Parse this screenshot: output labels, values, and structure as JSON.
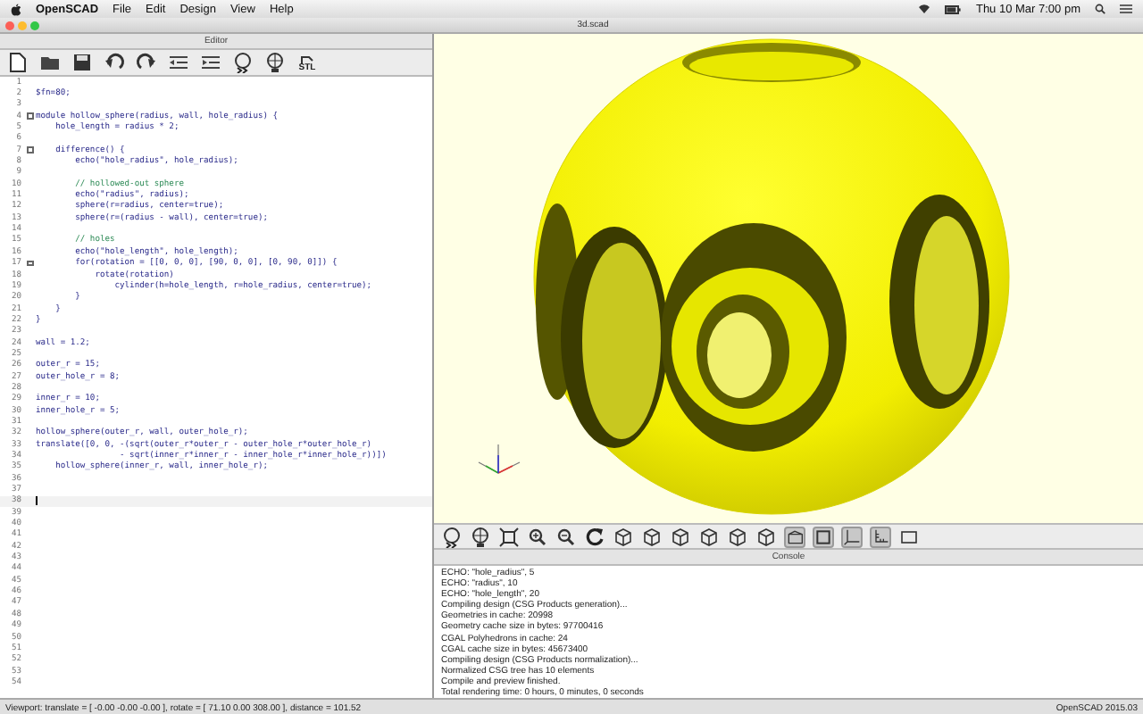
{
  "menubar": {
    "app": "OpenSCAD",
    "menus": [
      "File",
      "Edit",
      "Design",
      "View",
      "Help"
    ],
    "clock": "Thu 10 Mar  7:00 pm"
  },
  "window": {
    "title": "3d.scad"
  },
  "editor": {
    "title": "Editor",
    "toolbar": [
      {
        "kind": "new"
      },
      {
        "kind": "open"
      },
      {
        "kind": "save"
      },
      {
        "kind": "undo"
      },
      {
        "kind": "redo"
      },
      {
        "kind": "unindent"
      },
      {
        "kind": "indent"
      },
      {
        "kind": "preview"
      },
      {
        "kind": "render"
      },
      {
        "kind": "stl",
        "label": "STL"
      }
    ],
    "lines": [
      {
        "number": "1",
        "fold": false,
        "current": false
      },
      {
        "number": "2",
        "text": "$fn=80;",
        "kind": "code",
        "fold": false,
        "current": false
      },
      {
        "number": "3",
        "fold": false,
        "current": false
      },
      {
        "number": "4",
        "text": "module hollow_sphere(radius, wall, hole_radius) {",
        "kind": "code",
        "fold": true,
        "current": false
      },
      {
        "number": "5",
        "text": "    hole_length = radius * 2;",
        "kind": "code",
        "fold": false,
        "current": false
      },
      {
        "number": "6",
        "fold": false,
        "current": false
      },
      {
        "number": "7",
        "text": "    difference() {",
        "kind": "code",
        "fold": true,
        "current": false
      },
      {
        "number": "8",
        "text": "        echo(\"hole_radius\", hole_radius);",
        "kind": "code",
        "fold": false,
        "current": false
      },
      {
        "number": "9",
        "fold": false,
        "current": false
      },
      {
        "number": "10",
        "text": "        // hollowed-out sphere",
        "kind": "comment",
        "fold": false,
        "current": false
      },
      {
        "number": "11",
        "text": "        echo(\"radius\", radius);",
        "kind": "code",
        "fold": false,
        "current": false
      },
      {
        "number": "12",
        "text": "        sphere(r=radius, center=true);",
        "kind": "code",
        "fold": false,
        "current": false
      },
      {
        "number": "13",
        "text": "        sphere(r=(radius - wall), center=true);",
        "kind": "code",
        "fold": false,
        "current": false
      },
      {
        "number": "14",
        "fold": false,
        "current": false
      },
      {
        "number": "15",
        "text": "        // holes",
        "kind": "comment",
        "fold": false,
        "current": false
      },
      {
        "number": "16",
        "text": "        echo(\"hole_length\", hole_length);",
        "kind": "code",
        "fold": false,
        "current": false
      },
      {
        "number": "17",
        "text": "        for(rotation = [[0, 0, 0], [90, 0, 0], [0, 90, 0]]) {",
        "kind": "code",
        "fold": true,
        "current": false
      },
      {
        "number": "18",
        "text": "            rotate(rotation)",
        "kind": "code",
        "fold": false,
        "current": false
      },
      {
        "number": "19",
        "text": "                cylinder(h=hole_length, r=hole_radius, center=true);",
        "kind": "code",
        "fold": false,
        "current": false
      },
      {
        "number": "20",
        "text": "        }",
        "kind": "code",
        "fold": false,
        "current": false
      },
      {
        "number": "21",
        "text": "    }",
        "kind": "code",
        "fold": false,
        "current": false
      },
      {
        "number": "22",
        "text": "}",
        "kind": "code",
        "fold": false,
        "current": false
      },
      {
        "number": "23",
        "fold": false,
        "current": false
      },
      {
        "number": "24",
        "text": "wall = 1.2;",
        "kind": "code",
        "fold": false,
        "current": false
      },
      {
        "number": "25",
        "fold": false,
        "current": false
      },
      {
        "number": "26",
        "text": "outer_r = 15;",
        "kind": "code",
        "fold": false,
        "current": false
      },
      {
        "number": "27",
        "text": "outer_hole_r = 8;",
        "kind": "code",
        "fold": false,
        "current": false
      },
      {
        "number": "28",
        "fold": false,
        "current": false
      },
      {
        "number": "29",
        "text": "inner_r = 10;",
        "kind": "code",
        "fold": false,
        "current": false
      },
      {
        "number": "30",
        "text": "inner_hole_r = 5;",
        "kind": "code",
        "fold": false,
        "current": false
      },
      {
        "number": "31",
        "fold": false,
        "current": false
      },
      {
        "number": "32",
        "text": "hollow_sphere(outer_r, wall, outer_hole_r);",
        "kind": "code",
        "fold": false,
        "current": false
      },
      {
        "number": "33",
        "text": "translate([0, 0, -(sqrt(outer_r*outer_r - outer_hole_r*outer_hole_r)",
        "kind": "code",
        "fold": false,
        "current": false
      },
      {
        "number": "34",
        "text": "                 - sqrt(inner_r*inner_r - inner_hole_r*inner_hole_r))])",
        "kind": "code",
        "fold": false,
        "current": false
      },
      {
        "number": "35",
        "text": "    hollow_sphere(inner_r, wall, inner_hole_r);",
        "kind": "code",
        "fold": false,
        "current": false
      },
      {
        "number": "36",
        "fold": false,
        "current": false
      },
      {
        "number": "37",
        "fold": false,
        "current": false
      },
      {
        "number": "38",
        "fold": false,
        "current": true
      },
      {
        "number": "39",
        "fold": false,
        "current": false
      },
      {
        "number": "40",
        "fold": false,
        "current": false
      },
      {
        "number": "41",
        "fold": false,
        "current": false
      },
      {
        "number": "42",
        "fold": false,
        "current": false
      },
      {
        "number": "43",
        "fold": false,
        "current": false
      },
      {
        "number": "44",
        "fold": false,
        "current": false
      },
      {
        "number": "45",
        "fold": false,
        "current": false
      },
      {
        "number": "46",
        "fold": false,
        "current": false
      },
      {
        "number": "47",
        "fold": false,
        "current": false
      },
      {
        "number": "48",
        "fold": false,
        "current": false
      },
      {
        "number": "49",
        "fold": false,
        "current": false
      },
      {
        "number": "50",
        "fold": false,
        "current": false
      },
      {
        "number": "51",
        "fold": false,
        "current": false
      },
      {
        "number": "52",
        "fold": false,
        "current": false
      },
      {
        "number": "53",
        "fold": false,
        "current": false
      },
      {
        "number": "54",
        "fold": false,
        "current": false
      }
    ]
  },
  "viewport": {
    "toolbar": [
      {
        "kind": "preview",
        "on": false
      },
      {
        "kind": "render",
        "on": false
      },
      {
        "kind": "view-all",
        "on": false
      },
      {
        "kind": "zoom-in",
        "on": false
      },
      {
        "kind": "zoom-out",
        "on": false
      },
      {
        "kind": "reset",
        "on": false
      },
      {
        "kind": "cube",
        "on": false
      },
      {
        "kind": "cube",
        "on": false
      },
      {
        "kind": "cube",
        "on": false
      },
      {
        "kind": "cube",
        "on": false
      },
      {
        "kind": "cube",
        "on": false
      },
      {
        "kind": "cube",
        "on": false
      },
      {
        "kind": "perspective",
        "on": true
      },
      {
        "kind": "orthogonal",
        "on": true
      },
      {
        "kind": "axes",
        "on": true
      },
      {
        "kind": "scale",
        "on": true
      },
      {
        "kind": "edges",
        "on": false
      }
    ]
  },
  "console": {
    "title": "Console",
    "lines": [
      "ECHO: \"hole_radius\", 5",
      "ECHO: \"radius\", 10",
      "ECHO: \"hole_length\", 20",
      "Compiling design (CSG Products generation)...",
      "Geometries in cache: 20998",
      "Geometry cache size in bytes: 97700416",
      "CGAL Polyhedrons in cache: 24",
      "CGAL cache size in bytes: 45673400",
      "Compiling design (CSG Products normalization)...",
      "Normalized CSG tree has 10 elements",
      "Compile and preview finished.",
      "Total rendering time: 0 hours, 0 minutes, 0 seconds"
    ]
  },
  "status_bar": {
    "viewport": "Viewport: translate = [ -0.00 -0.00 -0.00 ], rotate = [ 71.10 0.00 308.00 ], distance = 101.52",
    "version": "OpenSCAD 2015.03"
  }
}
